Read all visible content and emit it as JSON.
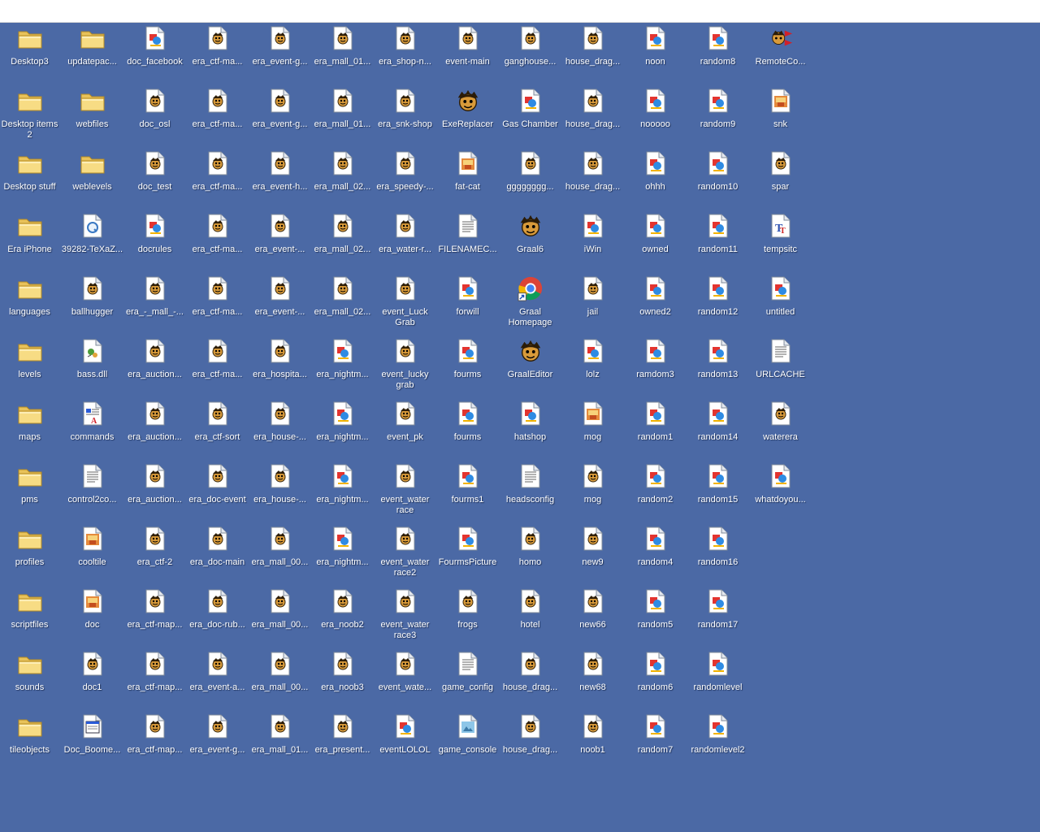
{
  "desktop": {
    "background_color": "#4b69a5",
    "columns": [
      [
        {
          "label": "Desktop3",
          "icon": "folder-icon"
        },
        {
          "label": "Desktop items 2",
          "icon": "folder-icon"
        },
        {
          "label": "Desktop stuff",
          "icon": "folder-icon"
        },
        {
          "label": "Era iPhone",
          "icon": "folder-icon"
        },
        {
          "label": "languages",
          "icon": "folder-icon"
        },
        {
          "label": "levels",
          "icon": "folder-icon"
        },
        {
          "label": "maps",
          "icon": "folder-icon"
        },
        {
          "label": "pms",
          "icon": "folder-icon"
        },
        {
          "label": "profiles",
          "icon": "folder-icon"
        },
        {
          "label": "scriptfiles",
          "icon": "folder-icon"
        },
        {
          "label": "sounds",
          "icon": "folder-icon"
        },
        {
          "label": "tileobjects",
          "icon": "folder-icon"
        }
      ],
      [
        {
          "label": "updatepac...",
          "icon": "folder-icon"
        },
        {
          "label": "webfiles",
          "icon": "folder-icon"
        },
        {
          "label": "weblevels",
          "icon": "folder-icon"
        },
        {
          "label": "39282-TeXaZ...",
          "icon": "quicktime-file-icon"
        },
        {
          "label": "ballhugger",
          "icon": "graal-script-file-icon"
        },
        {
          "label": "bass.dll",
          "icon": "dll-file-icon"
        },
        {
          "label": "commands",
          "icon": "rtf-document-icon"
        },
        {
          "label": "control2co...",
          "icon": "text-file-icon"
        },
        {
          "label": "cooltile",
          "icon": "image-file-icon"
        },
        {
          "label": "doc",
          "icon": "image-file-icon"
        },
        {
          "label": "doc1",
          "icon": "graal-script-file-icon"
        },
        {
          "label": "Doc_Boome...",
          "icon": "window-file-icon"
        }
      ],
      [
        {
          "label": "doc_facebook",
          "icon": "level-file-icon"
        },
        {
          "label": "doc_osl",
          "icon": "graal-script-file-icon"
        },
        {
          "label": "doc_test",
          "icon": "graal-script-file-icon"
        },
        {
          "label": "docrules",
          "icon": "level-file-icon"
        },
        {
          "label": "era_-_mall_-...",
          "icon": "graal-script-file-icon"
        },
        {
          "label": "era_auction...",
          "icon": "graal-script-file-icon"
        },
        {
          "label": "era_auction...",
          "icon": "graal-script-file-icon"
        },
        {
          "label": "era_auction...",
          "icon": "graal-script-file-icon"
        },
        {
          "label": "era_ctf-2",
          "icon": "graal-script-file-icon"
        },
        {
          "label": "era_ctf-map...",
          "icon": "graal-script-file-icon"
        },
        {
          "label": "era_ctf-map...",
          "icon": "graal-script-file-icon"
        },
        {
          "label": "era_ctf-map...",
          "icon": "graal-script-file-icon"
        }
      ],
      [
        {
          "label": "era_ctf-ma...",
          "icon": "graal-script-file-icon"
        },
        {
          "label": "era_ctf-ma...",
          "icon": "graal-script-file-icon"
        },
        {
          "label": "era_ctf-ma...",
          "icon": "graal-script-file-icon"
        },
        {
          "label": "era_ctf-ma...",
          "icon": "graal-script-file-icon"
        },
        {
          "label": "era_ctf-ma...",
          "icon": "graal-script-file-icon"
        },
        {
          "label": "era_ctf-ma...",
          "icon": "graal-script-file-icon"
        },
        {
          "label": "era_ctf-sort",
          "icon": "graal-script-file-icon"
        },
        {
          "label": "era_doc-event",
          "icon": "graal-script-file-icon"
        },
        {
          "label": "era_doc-main",
          "icon": "graal-script-file-icon"
        },
        {
          "label": "era_doc-rub...",
          "icon": "graal-script-file-icon"
        },
        {
          "label": "era_event-a...",
          "icon": "graal-script-file-icon"
        },
        {
          "label": "era_event-g...",
          "icon": "graal-script-file-icon"
        }
      ],
      [
        {
          "label": "era_event-g...",
          "icon": "graal-script-file-icon"
        },
        {
          "label": "era_event-g...",
          "icon": "graal-script-file-icon"
        },
        {
          "label": "era_event-h...",
          "icon": "graal-script-file-icon"
        },
        {
          "label": "era_event-...",
          "icon": "graal-script-file-icon"
        },
        {
          "label": "era_event-...",
          "icon": "graal-script-file-icon"
        },
        {
          "label": "era_hospita...",
          "icon": "graal-script-file-icon"
        },
        {
          "label": "era_house-...",
          "icon": "graal-script-file-icon"
        },
        {
          "label": "era_house-...",
          "icon": "graal-script-file-icon"
        },
        {
          "label": "era_mall_00...",
          "icon": "graal-script-file-icon"
        },
        {
          "label": "era_mall_00...",
          "icon": "graal-script-file-icon"
        },
        {
          "label": "era_mall_00...",
          "icon": "graal-script-file-icon"
        },
        {
          "label": "era_mall_01...",
          "icon": "graal-script-file-icon"
        }
      ],
      [
        {
          "label": "era_mall_01...",
          "icon": "graal-script-file-icon"
        },
        {
          "label": "era_mall_01...",
          "icon": "graal-script-file-icon"
        },
        {
          "label": "era_mall_02...",
          "icon": "graal-script-file-icon"
        },
        {
          "label": "era_mall_02...",
          "icon": "graal-script-file-icon"
        },
        {
          "label": "era_mall_02...",
          "icon": "graal-script-file-icon"
        },
        {
          "label": "era_nightm...",
          "icon": "level-file-icon"
        },
        {
          "label": "era_nightm...",
          "icon": "level-file-icon"
        },
        {
          "label": "era_nightm...",
          "icon": "level-file-icon"
        },
        {
          "label": "era_nightm...",
          "icon": "level-file-icon"
        },
        {
          "label": "era_noob2",
          "icon": "graal-script-file-icon"
        },
        {
          "label": "era_noob3",
          "icon": "graal-script-file-icon"
        },
        {
          "label": "era_present...",
          "icon": "graal-script-file-icon"
        }
      ],
      [
        {
          "label": "era_shop-n...",
          "icon": "graal-script-file-icon"
        },
        {
          "label": "era_snk-shop",
          "icon": "graal-script-file-icon"
        },
        {
          "label": "era_speedy-...",
          "icon": "graal-script-file-icon"
        },
        {
          "label": "era_water-r...",
          "icon": "graal-script-file-icon"
        },
        {
          "label": "event_Luck Grab",
          "icon": "graal-script-file-icon"
        },
        {
          "label": "event_lucky grab",
          "icon": "graal-script-file-icon"
        },
        {
          "label": "event_pk",
          "icon": "graal-script-file-icon"
        },
        {
          "label": "event_water race",
          "icon": "graal-script-file-icon"
        },
        {
          "label": "event_water race2",
          "icon": "graal-script-file-icon"
        },
        {
          "label": "event_water race3",
          "icon": "graal-script-file-icon"
        },
        {
          "label": "event_wate...",
          "icon": "graal-script-file-icon"
        },
        {
          "label": "eventLOLOL",
          "icon": "level-file-icon"
        }
      ],
      [
        {
          "label": "event-main",
          "icon": "graal-script-file-icon"
        },
        {
          "label": "ExeReplacer",
          "icon": "graal-app-icon"
        },
        {
          "label": "fat-cat",
          "icon": "image-file-icon"
        },
        {
          "label": "FILENAMEC...",
          "icon": "text-file-icon"
        },
        {
          "label": "forwill",
          "icon": "level-file-icon"
        },
        {
          "label": "fourms",
          "icon": "level-file-icon"
        },
        {
          "label": "fourms",
          "icon": "level-file-icon"
        },
        {
          "label": "fourms1",
          "icon": "level-file-icon"
        },
        {
          "label": "FourmsPicture",
          "icon": "level-file-icon"
        },
        {
          "label": "frogs",
          "icon": "graal-script-file-icon"
        },
        {
          "label": "game_config",
          "icon": "text-file-icon"
        },
        {
          "label": "game_console",
          "icon": "image-doc-icon"
        }
      ],
      [
        {
          "label": "ganghouse...",
          "icon": "graal-script-file-icon"
        },
        {
          "label": "Gas Chamber",
          "icon": "level-file-icon"
        },
        {
          "label": "gggggggg...",
          "icon": "graal-script-file-icon"
        },
        {
          "label": "Graal6",
          "icon": "graal-app-icon"
        },
        {
          "label": "Graal Homepage",
          "icon": "chrome-shortcut-icon"
        },
        {
          "label": "GraalEditor",
          "icon": "graal-app-icon"
        },
        {
          "label": "hatshop",
          "icon": "level-file-icon"
        },
        {
          "label": "headsconfig",
          "icon": "text-file-icon"
        },
        {
          "label": "homo",
          "icon": "graal-script-file-icon"
        },
        {
          "label": "hotel",
          "icon": "graal-script-file-icon"
        },
        {
          "label": "house_drag...",
          "icon": "graal-script-file-icon"
        },
        {
          "label": "house_drag...",
          "icon": "graal-script-file-icon"
        }
      ],
      [
        {
          "label": "house_drag...",
          "icon": "graal-script-file-icon"
        },
        {
          "label": "house_drag...",
          "icon": "graal-script-file-icon"
        },
        {
          "label": "house_drag...",
          "icon": "graal-script-file-icon"
        },
        {
          "label": "iWin",
          "icon": "level-file-icon"
        },
        {
          "label": "jail",
          "icon": "graal-script-file-icon"
        },
        {
          "label": "lolz",
          "icon": "level-file-icon"
        },
        {
          "label": "mog",
          "icon": "image-file-icon"
        },
        {
          "label": "mog",
          "icon": "graal-script-file-icon"
        },
        {
          "label": "new9",
          "icon": "graal-script-file-icon"
        },
        {
          "label": "new66",
          "icon": "graal-script-file-icon"
        },
        {
          "label": "new68",
          "icon": "graal-script-file-icon"
        },
        {
          "label": "noob1",
          "icon": "graal-script-file-icon"
        }
      ],
      [
        {
          "label": "noon",
          "icon": "level-file-icon"
        },
        {
          "label": "nooooo",
          "icon": "level-file-icon"
        },
        {
          "label": "ohhh",
          "icon": "level-file-icon"
        },
        {
          "label": "owned",
          "icon": "level-file-icon"
        },
        {
          "label": "owned2",
          "icon": "level-file-icon"
        },
        {
          "label": "ramdom3",
          "icon": "level-file-icon"
        },
        {
          "label": "random1",
          "icon": "level-file-icon"
        },
        {
          "label": "random2",
          "icon": "level-file-icon"
        },
        {
          "label": "random4",
          "icon": "level-file-icon"
        },
        {
          "label": "random5",
          "icon": "level-file-icon"
        },
        {
          "label": "random6",
          "icon": "level-file-icon"
        },
        {
          "label": "random7",
          "icon": "level-file-icon"
        }
      ],
      [
        {
          "label": "random8",
          "icon": "level-file-icon"
        },
        {
          "label": "random9",
          "icon": "level-file-icon"
        },
        {
          "label": "random10",
          "icon": "level-file-icon"
        },
        {
          "label": "random11",
          "icon": "level-file-icon"
        },
        {
          "label": "random12",
          "icon": "level-file-icon"
        },
        {
          "label": "random13",
          "icon": "level-file-icon"
        },
        {
          "label": "random14",
          "icon": "level-file-icon"
        },
        {
          "label": "random15",
          "icon": "level-file-icon"
        },
        {
          "label": "random16",
          "icon": "level-file-icon"
        },
        {
          "label": "random17",
          "icon": "level-file-icon"
        },
        {
          "label": "randomlevel",
          "icon": "level-file-icon"
        },
        {
          "label": "randomlevel2",
          "icon": "level-file-icon"
        }
      ],
      [
        {
          "label": "RemoteCo...",
          "icon": "remote-control-app-icon"
        },
        {
          "label": "snk",
          "icon": "image-file-icon"
        },
        {
          "label": "spar",
          "icon": "graal-script-file-icon"
        },
        {
          "label": "tempsitc",
          "icon": "font-file-icon"
        },
        {
          "label": "untitled",
          "icon": "level-file-icon"
        },
        {
          "label": "URLCACHE",
          "icon": "text-file-icon"
        },
        {
          "label": "waterera",
          "icon": "graal-script-file-icon"
        },
        {
          "label": "whatdoyou...",
          "icon": "level-file-icon"
        }
      ]
    ]
  }
}
